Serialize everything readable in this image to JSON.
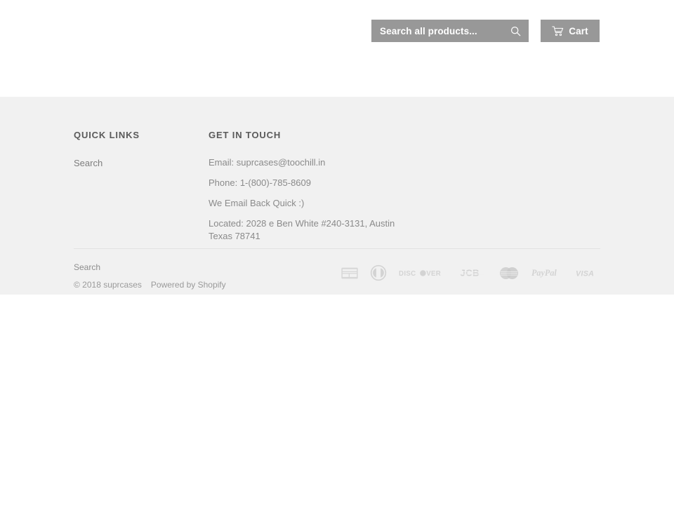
{
  "header": {
    "search": {
      "placeholder": "Search all products...",
      "value": "",
      "submit_icon": "search-icon"
    },
    "cart": {
      "label": "Cart",
      "icon": "shopping-cart-icon"
    }
  },
  "footer": {
    "quick_links": {
      "heading": "QUICK LINKS",
      "items": [
        {
          "label": "Search"
        }
      ]
    },
    "get_in_touch": {
      "heading": "GET IN TOUCH",
      "lines": [
        "Email: suprcases@toochill.in",
        "Phone: 1-(800)-785-8609",
        "We Email Back Quick :)",
        "Located: 2028 e Ben White #240-3131, Austin Texas 78741"
      ]
    },
    "bottom": {
      "nav": [
        {
          "label": "Search"
        }
      ],
      "copyright": "© 2018 suprcases",
      "powered_by": "Powered by Shopify",
      "payment_methods": [
        {
          "name": "american-express-icon",
          "label": "American Express"
        },
        {
          "name": "diners-club-icon",
          "label": "Diners Club"
        },
        {
          "name": "discover-icon",
          "label": "DISCOVER"
        },
        {
          "name": "jcb-icon",
          "label": "JCB"
        },
        {
          "name": "mastercard-icon",
          "label": "Master"
        },
        {
          "name": "paypal-icon",
          "label": "PayPal"
        },
        {
          "name": "visa-icon",
          "label": "VISA"
        }
      ]
    }
  },
  "colors": {
    "page_background": "#ffffff",
    "footer_background": "#f1f1f1",
    "control_grey": "#989898",
    "heading_text": "#5a5a5a",
    "body_text": "#8a8a8a",
    "divider": "#e2e2e2",
    "payment_icon": "#d2d2d2"
  }
}
